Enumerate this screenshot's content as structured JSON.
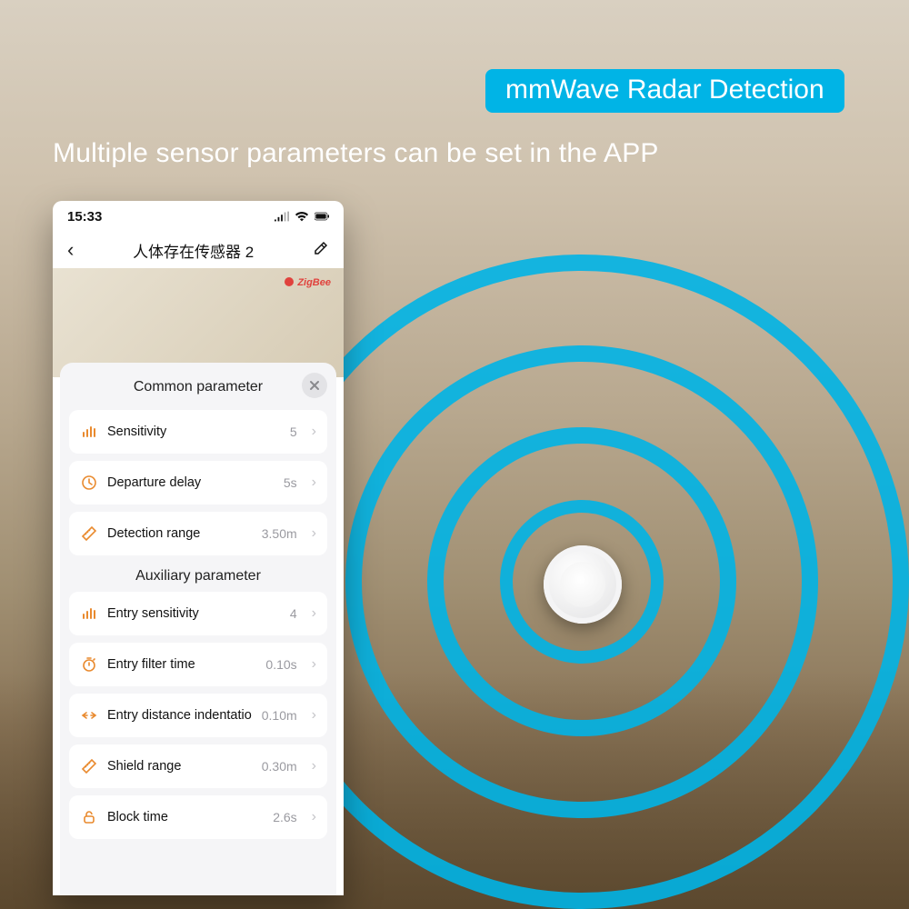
{
  "marketing": {
    "badge": "mmWave Radar Detection",
    "headline": "Multiple sensor parameters can be set in the APP"
  },
  "phone": {
    "status": {
      "time": "15:33"
    },
    "nav": {
      "title": "人体存在传感器 2"
    },
    "hero": {
      "protocol": "ZigBee"
    },
    "panel": {
      "section1_title": "Common parameter",
      "section2_title": "Auxiliary parameter",
      "rows": {
        "sensitivity": {
          "label": "Sensitivity",
          "value": "5"
        },
        "departure_delay": {
          "label": "Departure delay",
          "value": "5s"
        },
        "detection_range": {
          "label": "Detection range",
          "value": "3.50m"
        },
        "entry_sensitivity": {
          "label": "Entry sensitivity",
          "value": "4"
        },
        "entry_filter_time": {
          "label": "Entry filter time",
          "value": "0.10s"
        },
        "entry_distance": {
          "label": "Entry distance indentatio",
          "value": "0.10m"
        },
        "shield_range": {
          "label": "Shield range",
          "value": "0.30m"
        },
        "block_time": {
          "label": "Block time",
          "value": "2.6s"
        }
      }
    }
  }
}
